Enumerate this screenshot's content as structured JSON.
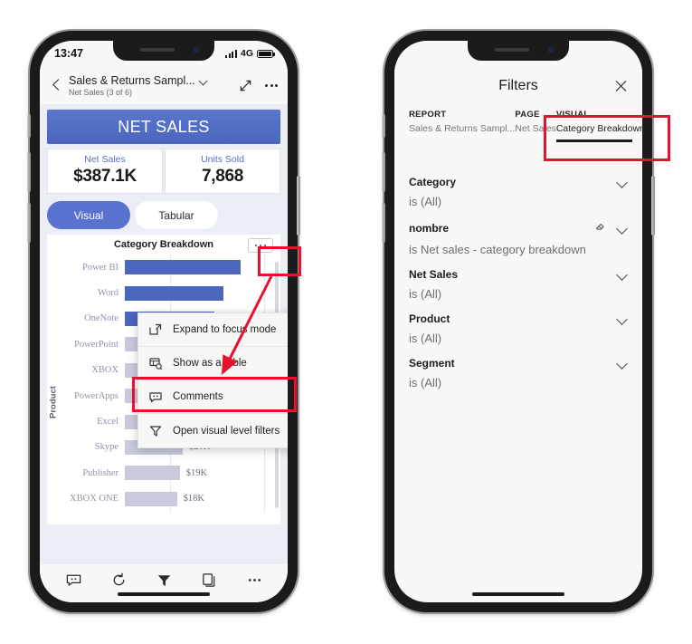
{
  "left_phone": {
    "status_bar": {
      "time": "13:47",
      "network": "4G",
      "signal_icon": "signal-bars-icon",
      "battery_icon": "battery-full-icon"
    },
    "header": {
      "back_icon": "chevron-left-icon",
      "title": "Sales & Returns Sampl...",
      "title_chevron_icon": "chevron-down-icon",
      "subtitle": "Net Sales (3 of 6)",
      "expand_icon": "expand-diagonal-icon",
      "more_icon": "ellipsis-icon"
    },
    "report": {
      "banner_label": "NET SALES",
      "kpis": [
        {
          "label": "Net Sales",
          "value": "$387.1K"
        },
        {
          "label": "Units Sold",
          "value": "7,868"
        }
      ],
      "toggle": {
        "selected": "Visual",
        "options": [
          "Visual",
          "Tabular"
        ]
      },
      "chart_title": "Category Breakdown",
      "chart_more_icon": "ellipsis-box-icon"
    },
    "context_menu": {
      "items": [
        {
          "label": "Expand to focus mode",
          "icon": "expand-focus-icon"
        },
        {
          "label": "Show as a table",
          "icon": "table-icon"
        },
        {
          "label": "Comments",
          "icon": "comment-icon"
        },
        {
          "label": "Open visual level filters",
          "icon": "funnel-icon"
        }
      ]
    },
    "bottom_bar": {
      "items": [
        {
          "name": "comments-button",
          "icon": "comment-icon"
        },
        {
          "name": "refresh-button",
          "icon": "refresh-icon"
        },
        {
          "name": "filters-button",
          "icon": "funnel-filled-icon"
        },
        {
          "name": "pages-button",
          "icon": "pages-icon"
        },
        {
          "name": "more-button",
          "icon": "ellipsis-icon"
        }
      ]
    }
  },
  "right_phone": {
    "header": {
      "title": "Filters",
      "close_icon": "close-icon"
    },
    "scopes": [
      {
        "key": "REPORT",
        "value": "Sales & Returns Sampl...",
        "active": false
      },
      {
        "key": "PAGE",
        "value": "Net Sales",
        "active": false
      },
      {
        "key": "VISUAL",
        "value": "Category Breakdown",
        "active": true
      }
    ],
    "filters": [
      {
        "name": "Category",
        "value": "is (All)",
        "has_clear": false,
        "chevron_icon": "chevron-down-icon"
      },
      {
        "name": "nombre",
        "value": "is Net sales - category breakdown",
        "has_clear": true,
        "clear_icon": "eraser-icon",
        "chevron_icon": "chevron-down-icon"
      },
      {
        "name": "Net Sales",
        "value": "is (All)",
        "has_clear": false,
        "chevron_icon": "chevron-down-icon"
      },
      {
        "name": "Product",
        "value": "is (All)",
        "has_clear": false,
        "chevron_icon": "chevron-down-icon"
      },
      {
        "name": "Segment",
        "value": "is (All)",
        "has_clear": false,
        "chevron_icon": "chevron-down-icon"
      }
    ]
  },
  "colors": {
    "accent_blue": "#4a66bd",
    "pill_blue": "#5a72cf",
    "bar_light": "#c9cbdd",
    "kpi_label_blue": "#5a6fc0",
    "annotation_red": "#e8112d",
    "canvas_bg": "#eceef5"
  },
  "chart_data": {
    "type": "bar",
    "title": "Category Breakdown",
    "orientation": "horizontal",
    "ylabel": "Product",
    "xlabel": "",
    "grid": true,
    "legend": null,
    "categories": [
      "Power BI",
      "Word",
      "OneNote",
      "PowerPoint",
      "XBOX",
      "PowerApps",
      "Excel",
      "Skype",
      "Publisher",
      "XBOX ONE"
    ],
    "values": [
      40,
      34,
      31,
      28,
      25,
      23,
      21,
      20,
      19,
      18
    ],
    "value_labels": [
      "",
      "",
      "",
      "",
      "",
      "$23K",
      "$21K",
      "$20K",
      "$19K",
      "$18K"
    ],
    "highlighted": [
      "Power BI",
      "Word",
      "OneNote"
    ],
    "units": "K"
  }
}
